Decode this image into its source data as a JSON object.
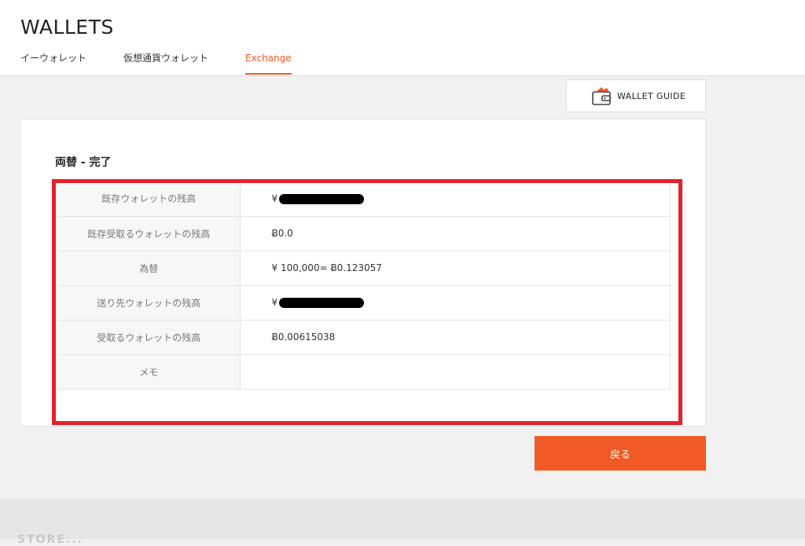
{
  "header": {
    "title": "WALLETS",
    "tabs": [
      {
        "label": "イーウォレット"
      },
      {
        "label": "仮想通貨ウォレット"
      },
      {
        "label": "Exchange"
      }
    ]
  },
  "guide": {
    "label": "WALLET GUIDE",
    "icon": "wallet-icon"
  },
  "section": {
    "title": "両替 - 完了"
  },
  "rows": [
    {
      "label": "既存ウォレットの残高",
      "value": "¥"
    },
    {
      "label": "既存受取るウォレットの残高",
      "value": "Ƀ0.0"
    },
    {
      "label": "為替",
      "value": "¥ 100,000= Ƀ0.123057"
    },
    {
      "label": "送り先ウォレットの残高",
      "value": "¥"
    },
    {
      "label": "受取るウォレットの残高",
      "value": "Ƀ0.00615038"
    },
    {
      "label": "メモ",
      "value": ""
    }
  ],
  "actions": {
    "back_label": "戻る"
  },
  "footer": {
    "logo_text": "STORE..."
  },
  "colors": {
    "accent": "#f15a24",
    "highlight": "#e8202a"
  }
}
